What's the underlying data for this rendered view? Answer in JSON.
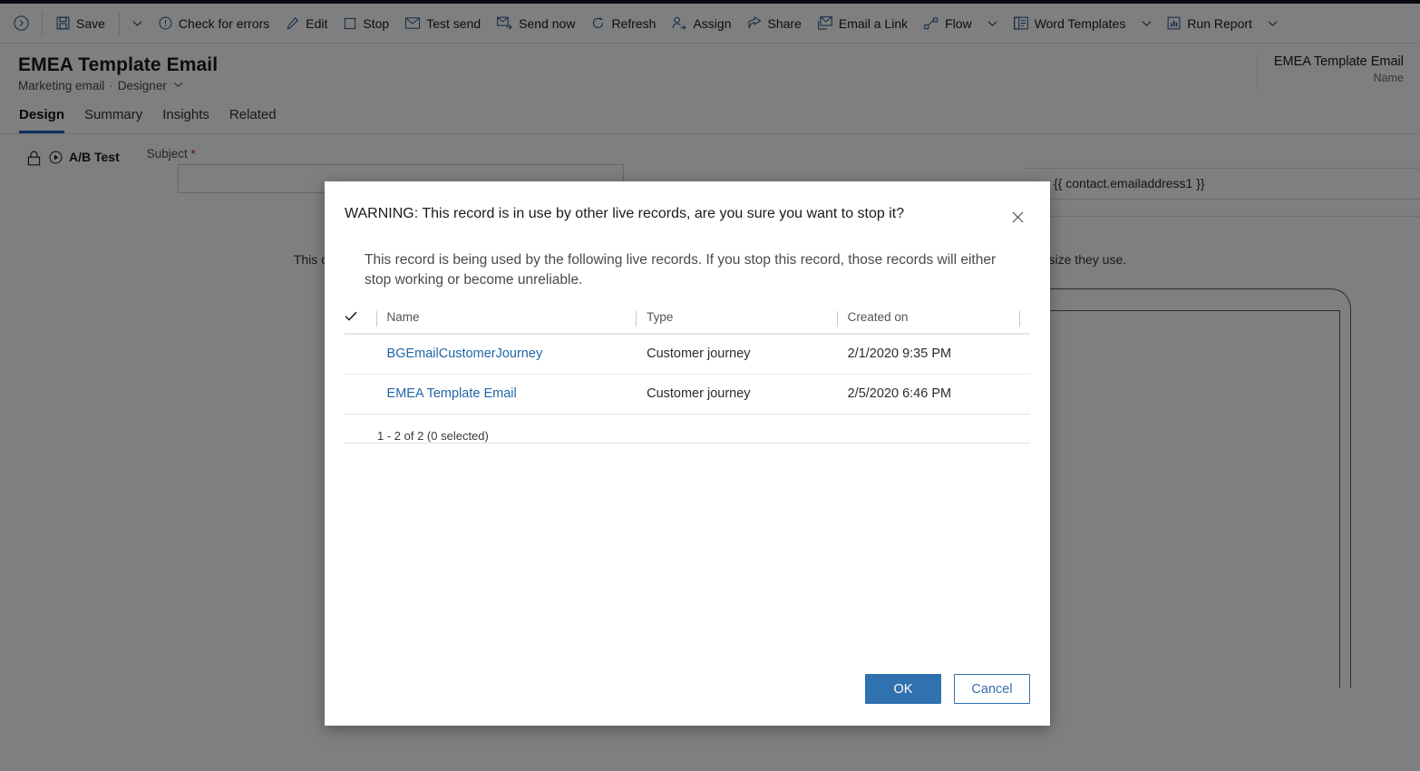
{
  "toolbar": {
    "expand_icon": "chevron-circle-right-icon",
    "items": [
      {
        "label": "Save",
        "icon": "save-icon",
        "has_caret": false
      },
      {
        "label": "",
        "icon": "chevron-down-icon",
        "caret_only": true
      },
      {
        "label": "Check for errors",
        "icon": "alert-circle-icon",
        "has_caret": false
      },
      {
        "label": "Edit",
        "icon": "pencil-icon",
        "has_caret": false
      },
      {
        "label": "Stop",
        "icon": "stop-square-icon",
        "has_caret": false
      },
      {
        "label": "Test send",
        "icon": "envelope-icon",
        "has_caret": false
      },
      {
        "label": "Send now",
        "icon": "send-mail-icon",
        "has_caret": false
      },
      {
        "label": "Refresh",
        "icon": "refresh-icon",
        "has_caret": false
      },
      {
        "label": "Assign",
        "icon": "assign-person-icon",
        "has_caret": false
      },
      {
        "label": "Share",
        "icon": "share-icon",
        "has_caret": false
      },
      {
        "label": "Email a Link",
        "icon": "email-link-icon",
        "has_caret": false
      },
      {
        "label": "Flow",
        "icon": "flow-icon",
        "has_caret": true
      },
      {
        "label": "Word Templates",
        "icon": "word-template-icon",
        "has_caret": true
      },
      {
        "label": "Run Report",
        "icon": "report-icon",
        "has_caret": true
      }
    ]
  },
  "record": {
    "title": "EMEA Template Email",
    "entity": "Marketing email",
    "separator": "·",
    "mode": "Designer",
    "header_value": "EMEA Template Email",
    "header_label": "Name"
  },
  "tabs": [
    {
      "label": "Design",
      "active": true
    },
    {
      "label": "Summary",
      "active": false
    },
    {
      "label": "Insights",
      "active": false
    },
    {
      "label": "Related",
      "active": false
    }
  ],
  "designer": {
    "lock_icon": "lock-icon",
    "abtest_icon": "play-circle-icon",
    "abtest_label": "A/B Test",
    "subject_label": "Subject",
    "subject_required": "*",
    "subject_value": "",
    "email_value": "{{ contact.emailaddress1 }}",
    "canvas_message": "This content was not created for mobile, so your recipients may have problems reading it, depending on which email client and screen size they use."
  },
  "dialog": {
    "title": "WARNING: This record is in use by other live records, are you sure you want to stop it?",
    "close_icon": "close-icon",
    "description": "This record is being used by the following live records. If you stop this record, those records will either stop working or become unreliable.",
    "grid": {
      "select_all_icon": "checkmark-icon",
      "columns": [
        "Name",
        "Type",
        "Created on"
      ],
      "rows": [
        {
          "name": "BGEmailCustomerJourney",
          "type": "Customer journey",
          "created_on": "2/1/2020 9:35 PM"
        },
        {
          "name": "EMEA Template Email",
          "type": "Customer journey",
          "created_on": "2/5/2020 6:46 PM"
        }
      ],
      "footer": "1 - 2 of 2 (0 selected)"
    },
    "ok_label": "OK",
    "cancel_label": "Cancel"
  },
  "colors": {
    "accent": "#1f5fbf",
    "primary_button": "#3071b0",
    "link": "#2266a8",
    "required": "#b60016",
    "icon_blue": "#1b4e8a",
    "overlay": "#808080"
  }
}
